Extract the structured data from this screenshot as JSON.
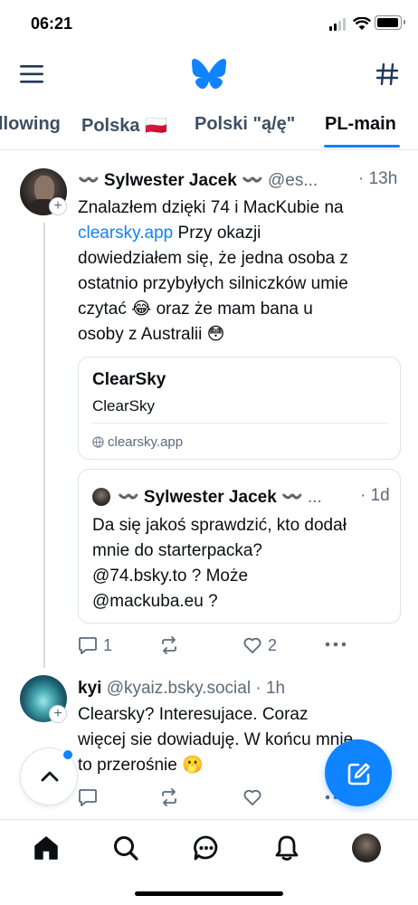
{
  "status_bar": {
    "time": "06:21"
  },
  "header": {
    "menu_icon": "hamburger-icon",
    "logo": "butterfly-logo",
    "feeds_icon": "hash-icon"
  },
  "tabs": [
    {
      "label": "llowing"
    },
    {
      "label": "Polska 🇵🇱"
    },
    {
      "label": "Polski \"ą/ę\""
    },
    {
      "label": "PL-main",
      "active": true
    }
  ],
  "post1": {
    "author": "〰️ Sylwester Jacek 〰️",
    "handle": "@es...",
    "time": "· 13h",
    "text_lines": [
      "Znalazłem dzięki 74 i MacKubie na",
      "clearsky.app",
      " Przy okazji",
      "dowiedziałem się, że jedna osoba z",
      "ostatnio przybyłych silniczków umie",
      "czytać 😂 oraz że mam bana u",
      "osoby z Australii 😳"
    ],
    "link_card": {
      "title": "ClearSky",
      "description": "ClearSky",
      "domain": "clearsky.app"
    },
    "quote": {
      "author": "〰️ Sylwester Jacek 〰️",
      "handle": "...",
      "time": "· 1d",
      "text_lines": [
        "Da się jakoś sprawdzić, kto dodał",
        "mnie do starterpacka?",
        "@74.bsky.to ? Może",
        "@mackuba.eu ?"
      ]
    },
    "replies": "1",
    "reposts": "",
    "likes": "2"
  },
  "post2": {
    "author": "kyi",
    "handle": "@kyaiz.bsky.social",
    "time": "· 1h",
    "text_lines": [
      "Clearsky?  Interesujace. Coraz",
      "więcej sie dowiaduję. W końcu mnie",
      "to przerośnie 🫢"
    ]
  },
  "colors": {
    "accent": "#1083fe",
    "text": "#0b0f14",
    "muted": "#5c6b7a"
  },
  "fab": {
    "icon": "compose-icon"
  },
  "scroll_top": {
    "icon": "chevron-up-icon"
  },
  "bottom_nav": [
    "home-icon",
    "search-icon",
    "chat-icon",
    "bell-icon",
    "profile-avatar"
  ]
}
